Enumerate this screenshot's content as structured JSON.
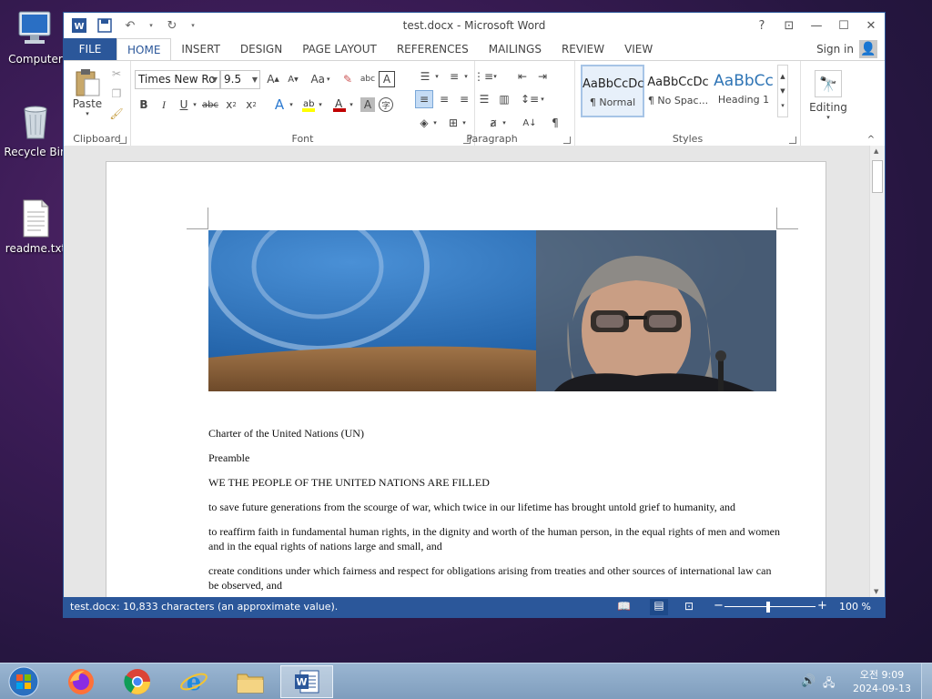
{
  "desktop": {
    "icons": [
      {
        "label": "Computer",
        "icon": "computer-icon"
      },
      {
        "label": "Recycle Bin",
        "icon": "recycle-bin-icon"
      },
      {
        "label": "readme.txt",
        "icon": "text-file-icon"
      }
    ]
  },
  "window": {
    "title": "test.docx - Microsoft Word",
    "help": "?",
    "sign_in": "Sign in"
  },
  "tabs": [
    "FILE",
    "HOME",
    "INSERT",
    "DESIGN",
    "PAGE LAYOUT",
    "REFERENCES",
    "MAILINGS",
    "REVIEW",
    "VIEW"
  ],
  "active_tab": "HOME",
  "ribbon": {
    "clipboard": {
      "label": "Clipboard",
      "paste": "Paste"
    },
    "font": {
      "label": "Font",
      "family": "Times New Ro",
      "size": "9.5",
      "change_case": "Aa"
    },
    "paragraph": {
      "label": "Paragraph"
    },
    "styles": {
      "label": "Styles",
      "items": [
        {
          "preview": "AaBbCcDc",
          "name": "¶ Normal"
        },
        {
          "preview": "AaBbCcDc",
          "name": "¶ No Spac..."
        },
        {
          "preview": "AaBbCc",
          "name": "Heading 1"
        }
      ]
    },
    "editing": {
      "label": "Editing"
    }
  },
  "document": {
    "paragraphs": [
      "Charter of the United Nations (UN)",
      "Preamble",
      "WE THE PEOPLE OF THE UNITED NATIONS ARE FILLED",
      "to save future generations from the scourge of war, which twice in our lifetime has brought untold grief to humanity, and",
      "to reaffirm faith in fundamental human rights, in the dignity and worth of the human person, in the equal rights of men and women and in the equal rights of nations large and small, and",
      "create conditions under which fairness and respect for obligations arising from treaties and other sources of international law can be observed, and"
    ]
  },
  "status": {
    "info": "test.docx: 10,833 characters (an approximate value).",
    "zoom": "100 %"
  },
  "taskbar": {
    "apps": [
      "start-orb",
      "firefox",
      "chrome",
      "internet-explorer",
      "file-explorer",
      "word"
    ],
    "time": "오전 9:09",
    "date": "2024-09-13"
  },
  "colors": {
    "word_blue": "#2b579a",
    "accent_red": "#c00000",
    "highlight_yellow": "#ffff00"
  }
}
